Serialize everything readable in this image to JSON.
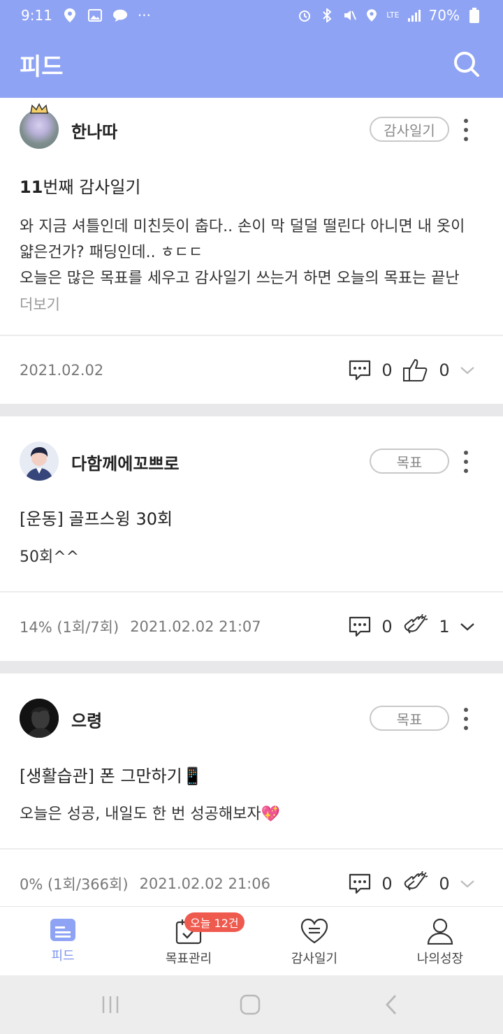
{
  "status": {
    "time": "9:11",
    "battery": "70%",
    "network": "LTE"
  },
  "appbar": {
    "title": "피드"
  },
  "colors": {
    "primary": "#8ea3f4",
    "badge": "#ef5a4f",
    "active_tab": "#7d93ee"
  },
  "posts": [
    {
      "user": "한나따",
      "tag": "감사일기",
      "title_num": "11",
      "title_rest": "번째 감사일기",
      "body_lines": [
        "와 지금 셔틀인데 미친듯이 춥다.. 손이 막 덜덜 떨린다 아니면 내 옷이",
        "얇은건가? 패딩인데.. ㅎㄷㄷ",
        "오늘은 많은 목표를 세우고 감사일기 쓰는거 하면 오늘의 목표는 끝난"
      ],
      "more": "더보기",
      "date": "2021.02.02",
      "comments": "0",
      "likes": "0"
    },
    {
      "user": "다함께에꼬쁘로",
      "tag": "목표",
      "title": "[운동] 골프스윙 30회",
      "body": "50회^^",
      "progress": "14% (1회/7회)",
      "date": "2021.02.02 21:07",
      "comments": "0",
      "cheers": "1"
    },
    {
      "user": "으령",
      "tag": "목표",
      "title": "[생활습관] 폰 그만하기📱",
      "body": "오늘은 성공, 내일도 한 번 성공해보자💖",
      "progress": "0% (1회/366회)",
      "date": "2021.02.02 21:06",
      "comments": "0",
      "cheers": "0"
    }
  ],
  "nav": {
    "feed": "피드",
    "goals": "목표관리",
    "gratitude": "감사일기",
    "growth": "나의성장",
    "badge": "오늘 12건"
  }
}
